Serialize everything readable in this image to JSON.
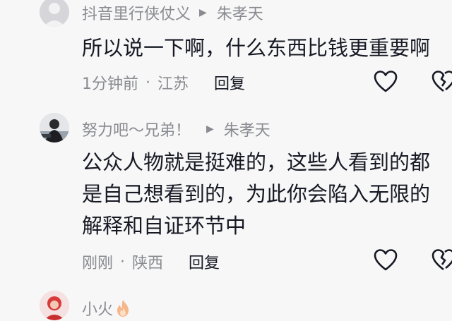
{
  "comments": [
    {
      "author": "抖音里行侠仗义",
      "reply_to": "朱孝天",
      "lines": [
        "所以说一下啊，什么东西比钱更重要啊"
      ],
      "time": "1分钟前",
      "location": "江苏",
      "reply_label": "回复"
    },
    {
      "author": "努力吧～兄弟！",
      "reply_to": "朱孝天",
      "lines": [
        "公众人物就是挺难的，这些人看到的都",
        "是自己想看到的，为此你会陷入无限的",
        "解释和自证环节中"
      ],
      "time": "刚刚",
      "location": "陕西",
      "reply_label": "回复"
    },
    {
      "author": "小火"
    }
  ],
  "separator": "·",
  "reply_arrow": "▶",
  "icons": {
    "like": "heart-outline-icon",
    "dislike": "broken-heart-icon",
    "flame": "flame-emoji-icon"
  },
  "colors": {
    "meta": "#8a8b91",
    "text": "#161823",
    "background": "#f7f7f7"
  }
}
